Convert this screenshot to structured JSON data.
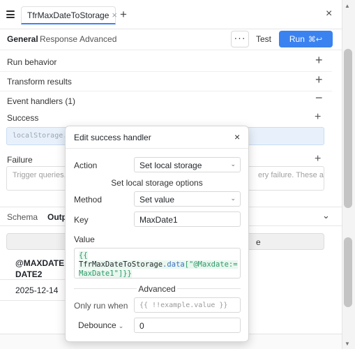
{
  "topbar": {
    "query_tab_label": "TfrMaxDateToStorage",
    "new_tab_symbol": "+",
    "close_symbol": "×"
  },
  "subtabs": [
    "General",
    "Response",
    "Advanced"
  ],
  "actions": {
    "more_label": "···",
    "test_label": "Test",
    "run_label": "Run",
    "run_shortcut": "⌘↩"
  },
  "sections": {
    "run_behavior": "Run behavior",
    "transform_results": "Transform results",
    "event_handlers": "Event handlers (1)"
  },
  "success": {
    "label": "Success",
    "handler_preview": "localStorage.s"
  },
  "failure": {
    "label": "Failure",
    "placeholder_left": "Trigger queries,",
    "placeholder_right": "ery failure. These are"
  },
  "lower_tabs": [
    "Schema",
    "Outp"
  ],
  "output": {
    "filter_tail": "e",
    "column_header_line1": "@MAXDATE :=",
    "column_header_line2": "DATE2",
    "cell_value": "2025-12-14"
  },
  "modal": {
    "title": "Edit success handler",
    "close_symbol": "×",
    "action_label": "Action",
    "action_value": "Set local storage",
    "options_heading": "Set local storage options",
    "method_label": "Method",
    "method_value": "Set value",
    "key_label": "Key",
    "key_value": "MaxDate1",
    "value_label": "Value",
    "value_code_line1_open": "{{",
    "value_code_line1_ident": "TfrMaxDateToStorage",
    "value_code_line1_prop": ".data",
    "value_code_line1_str": "[\"@Maxdate:=",
    "value_code_line2": "MaxDate1\"]}}",
    "advanced_heading": "Advanced",
    "only_run_when_label": "Only run when",
    "only_run_when_placeholder": "{{ !!example.value }}",
    "debounce_label": "Debounce",
    "debounce_value": "0"
  },
  "colors": {
    "primary": "#3a82f0",
    "success_chip_bg": "#e8f1fb",
    "code_green": "#2b9a66"
  }
}
